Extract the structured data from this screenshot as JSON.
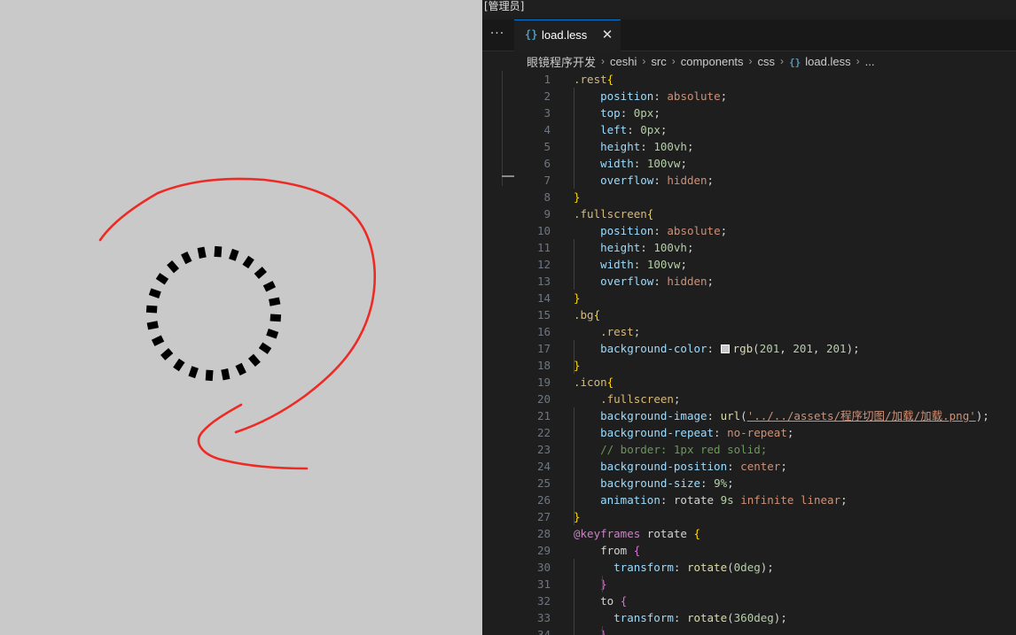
{
  "window": {
    "title": "[管理员]"
  },
  "tabs": [
    {
      "icon": "{}",
      "label": "load.less",
      "close": "✕"
    }
  ],
  "more_label": "···",
  "breadcrumb": [
    "眼镜程序开发",
    "ceshi",
    "src",
    "components",
    "css",
    "load.less",
    "..."
  ],
  "breadcrumb_separator": "›",
  "colors": {
    "canvas_bg": "#c9c9c9",
    "spinner": "#000000",
    "annotation": "#ee2a24",
    "editor_bg": "#1e1e1e",
    "swatch": "#c9c9c9"
  },
  "icons": {
    "file_icon": "curly-braces-icon",
    "more": "ellipsis-icon",
    "close": "close-icon"
  },
  "code_lines": [
    {
      "n": "1",
      "t": [
        {
          "c": "sel",
          "s": ".rest"
        },
        {
          "c": "brace",
          "s": "{"
        }
      ]
    },
    {
      "n": "2",
      "t": [
        {
          "c": "",
          "s": "    "
        },
        {
          "c": "prop",
          "s": "position"
        },
        {
          "c": "",
          "s": ": "
        },
        {
          "c": "val",
          "s": "absolute"
        },
        {
          "c": "",
          "s": ";"
        }
      ]
    },
    {
      "n": "3",
      "t": [
        {
          "c": "",
          "s": "    "
        },
        {
          "c": "prop",
          "s": "top"
        },
        {
          "c": "",
          "s": ": "
        },
        {
          "c": "num",
          "s": "0px"
        },
        {
          "c": "",
          "s": ";"
        }
      ]
    },
    {
      "n": "4",
      "t": [
        {
          "c": "",
          "s": "    "
        },
        {
          "c": "prop",
          "s": "left"
        },
        {
          "c": "",
          "s": ": "
        },
        {
          "c": "num",
          "s": "0px"
        },
        {
          "c": "",
          "s": ";"
        }
      ]
    },
    {
      "n": "5",
      "t": [
        {
          "c": "",
          "s": "    "
        },
        {
          "c": "prop",
          "s": "height"
        },
        {
          "c": "",
          "s": ": "
        },
        {
          "c": "num",
          "s": "100vh"
        },
        {
          "c": "",
          "s": ";"
        }
      ]
    },
    {
      "n": "6",
      "t": [
        {
          "c": "",
          "s": "    "
        },
        {
          "c": "prop",
          "s": "width"
        },
        {
          "c": "",
          "s": ": "
        },
        {
          "c": "num",
          "s": "100vw"
        },
        {
          "c": "",
          "s": ";"
        }
      ]
    },
    {
      "n": "7",
      "t": [
        {
          "c": "",
          "s": "    "
        },
        {
          "c": "prop",
          "s": "overflow"
        },
        {
          "c": "",
          "s": ": "
        },
        {
          "c": "val",
          "s": "hidden"
        },
        {
          "c": "",
          "s": ";"
        }
      ]
    },
    {
      "n": "8",
      "t": [
        {
          "c": "brace",
          "s": "}"
        }
      ]
    },
    {
      "n": "9",
      "t": [
        {
          "c": "sel",
          "s": ".fullscreen"
        },
        {
          "c": "brace",
          "s": "{"
        }
      ]
    },
    {
      "n": "10",
      "t": [
        {
          "c": "",
          "s": "    "
        },
        {
          "c": "prop",
          "s": "position"
        },
        {
          "c": "",
          "s": ": "
        },
        {
          "c": "val",
          "s": "absolute"
        },
        {
          "c": "",
          "s": ";"
        }
      ]
    },
    {
      "n": "11",
      "t": [
        {
          "c": "",
          "s": "    "
        },
        {
          "c": "prop",
          "s": "height"
        },
        {
          "c": "",
          "s": ": "
        },
        {
          "c": "num",
          "s": "100vh"
        },
        {
          "c": "",
          "s": ";"
        }
      ]
    },
    {
      "n": "12",
      "t": [
        {
          "c": "",
          "s": "    "
        },
        {
          "c": "prop",
          "s": "width"
        },
        {
          "c": "",
          "s": ": "
        },
        {
          "c": "num",
          "s": "100vw"
        },
        {
          "c": "",
          "s": ";"
        }
      ]
    },
    {
      "n": "13",
      "t": [
        {
          "c": "",
          "s": "    "
        },
        {
          "c": "prop",
          "s": "overflow"
        },
        {
          "c": "",
          "s": ": "
        },
        {
          "c": "val",
          "s": "hidden"
        },
        {
          "c": "",
          "s": ";"
        }
      ]
    },
    {
      "n": "14",
      "t": [
        {
          "c": "brace",
          "s": "}"
        }
      ]
    },
    {
      "n": "15",
      "t": [
        {
          "c": "sel",
          "s": ".bg"
        },
        {
          "c": "brace",
          "s": "{"
        }
      ]
    },
    {
      "n": "16",
      "t": [
        {
          "c": "",
          "s": "    "
        },
        {
          "c": "sel",
          "s": ".rest"
        },
        {
          "c": "",
          "s": ";"
        }
      ]
    },
    {
      "n": "17",
      "t": [
        {
          "c": "",
          "s": "    "
        },
        {
          "c": "prop",
          "s": "background-color"
        },
        {
          "c": "",
          "s": ": "
        },
        {
          "c": "swatch",
          "s": ""
        },
        {
          "c": "fn",
          "s": "rgb"
        },
        {
          "c": "",
          "s": "("
        },
        {
          "c": "num",
          "s": "201"
        },
        {
          "c": "",
          "s": ", "
        },
        {
          "c": "num",
          "s": "201"
        },
        {
          "c": "",
          "s": ", "
        },
        {
          "c": "num",
          "s": "201"
        },
        {
          "c": "",
          "s": ");"
        }
      ]
    },
    {
      "n": "18",
      "t": [
        {
          "c": "brace",
          "s": "}"
        }
      ]
    },
    {
      "n": "19",
      "t": [
        {
          "c": "sel",
          "s": ".icon"
        },
        {
          "c": "brace",
          "s": "{"
        }
      ]
    },
    {
      "n": "20",
      "t": [
        {
          "c": "",
          "s": "    "
        },
        {
          "c": "sel",
          "s": ".fullscreen"
        },
        {
          "c": "",
          "s": ";"
        }
      ]
    },
    {
      "n": "21",
      "t": [
        {
          "c": "",
          "s": "    "
        },
        {
          "c": "prop",
          "s": "background-image"
        },
        {
          "c": "",
          "s": ": "
        },
        {
          "c": "fn",
          "s": "url"
        },
        {
          "c": "",
          "s": "("
        },
        {
          "c": "str",
          "s": "'../../assets/程序切图/加载/加载.png'"
        },
        {
          "c": "",
          "s": ");"
        }
      ]
    },
    {
      "n": "22",
      "t": [
        {
          "c": "",
          "s": "    "
        },
        {
          "c": "prop",
          "s": "background-repeat"
        },
        {
          "c": "",
          "s": ": "
        },
        {
          "c": "val",
          "s": "no-repeat"
        },
        {
          "c": "",
          "s": ";"
        }
      ]
    },
    {
      "n": "23",
      "t": [
        {
          "c": "",
          "s": "    "
        },
        {
          "c": "com",
          "s": "// border: 1px red solid;"
        }
      ]
    },
    {
      "n": "24",
      "t": [
        {
          "c": "",
          "s": "    "
        },
        {
          "c": "prop",
          "s": "background-position"
        },
        {
          "c": "",
          "s": ": "
        },
        {
          "c": "val",
          "s": "center"
        },
        {
          "c": "",
          "s": ";"
        }
      ]
    },
    {
      "n": "25",
      "t": [
        {
          "c": "",
          "s": "    "
        },
        {
          "c": "prop",
          "s": "background-size"
        },
        {
          "c": "",
          "s": ": "
        },
        {
          "c": "num",
          "s": "9%"
        },
        {
          "c": "",
          "s": ";"
        }
      ]
    },
    {
      "n": "26",
      "t": [
        {
          "c": "",
          "s": "    "
        },
        {
          "c": "prop",
          "s": "animation"
        },
        {
          "c": "",
          "s": ": "
        },
        {
          "c": "",
          "s": "rotate "
        },
        {
          "c": "num",
          "s": "9s"
        },
        {
          "c": "",
          "s": " "
        },
        {
          "c": "val",
          "s": "infinite"
        },
        {
          "c": "",
          "s": " "
        },
        {
          "c": "val",
          "s": "linear"
        },
        {
          "c": "",
          "s": ";"
        }
      ]
    },
    {
      "n": "27",
      "t": [
        {
          "c": "brace",
          "s": "}"
        }
      ]
    },
    {
      "n": "28",
      "t": [
        {
          "c": "at",
          "s": "@keyframes"
        },
        {
          "c": "",
          "s": " rotate "
        },
        {
          "c": "brace",
          "s": "{"
        }
      ]
    },
    {
      "n": "29",
      "t": [
        {
          "c": "",
          "s": "    from "
        },
        {
          "c": "brace2",
          "s": "{"
        }
      ]
    },
    {
      "n": "30",
      "t": [
        {
          "c": "",
          "s": "      "
        },
        {
          "c": "prop",
          "s": "transform"
        },
        {
          "c": "",
          "s": ": "
        },
        {
          "c": "fn",
          "s": "rotate"
        },
        {
          "c": "",
          "s": "("
        },
        {
          "c": "num",
          "s": "0deg"
        },
        {
          "c": "",
          "s": ");"
        }
      ]
    },
    {
      "n": "31",
      "t": [
        {
          "c": "",
          "s": "    "
        },
        {
          "c": "brace2",
          "s": "}"
        }
      ]
    },
    {
      "n": "32",
      "t": [
        {
          "c": "",
          "s": "    to "
        },
        {
          "c": "brace2",
          "s": "{"
        }
      ]
    },
    {
      "n": "33",
      "t": [
        {
          "c": "",
          "s": "      "
        },
        {
          "c": "prop",
          "s": "transform"
        },
        {
          "c": "",
          "s": ": "
        },
        {
          "c": "fn",
          "s": "rotate"
        },
        {
          "c": "",
          "s": "("
        },
        {
          "c": "num",
          "s": "360deg"
        },
        {
          "c": "",
          "s": ");"
        }
      ]
    },
    {
      "n": "34",
      "t": [
        {
          "c": "",
          "s": "    "
        },
        {
          "c": "brace2",
          "s": "}"
        }
      ]
    }
  ]
}
